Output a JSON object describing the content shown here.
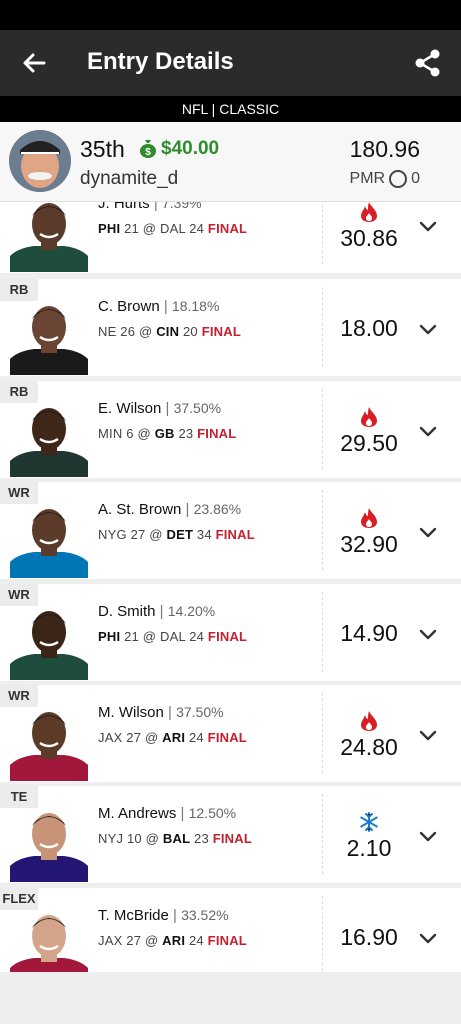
{
  "header": {
    "title": "Entry Details",
    "subtitle": "NFL | CLASSIC"
  },
  "entry": {
    "rank": "35th",
    "winnings": "$40.00",
    "username": "dynamite_d",
    "score": "180.96",
    "pmr_label": "PMR",
    "pmr_value": "0"
  },
  "colors": {
    "accent_green": "#2e8b2e",
    "final_red": "#c4212f",
    "hot": "#d91f26",
    "cold": "#1b7fcc"
  },
  "players": [
    {
      "pos": "",
      "name": "J. Hurts",
      "own": "7.39%",
      "t1": "PHI",
      "s1": "21",
      "at": "@",
      "t2": "DAL",
      "s2": "24",
      "status": "FINAL",
      "bold_team": "t1",
      "points": "30.86",
      "trend": "hot-icon",
      "skin": "#5a3a2a",
      "jersey": "#1f4d3d"
    },
    {
      "pos": "RB",
      "name": "C. Brown",
      "own": "18.18%",
      "t1": "NE",
      "s1": "26",
      "at": "@",
      "t2": "CIN",
      "s2": "20",
      "status": "FINAL",
      "bold_team": "t2",
      "points": "18.00",
      "trend": "",
      "skin": "#6b4533",
      "jersey": "#1a1a1a"
    },
    {
      "pos": "RB",
      "name": "E. Wilson",
      "own": "37.50%",
      "t1": "MIN",
      "s1": "6",
      "at": "@",
      "t2": "GB",
      "s2": "23",
      "status": "FINAL",
      "bold_team": "t2",
      "points": "29.50",
      "trend": "hot-icon",
      "skin": "#3e2619",
      "jersey": "#203731"
    },
    {
      "pos": "WR",
      "name": "A. St. Brown",
      "own": "23.86%",
      "t1": "NYG",
      "s1": "27",
      "at": "@",
      "t2": "DET",
      "s2": "34",
      "status": "FINAL",
      "bold_team": "t2",
      "points": "32.90",
      "trend": "hot-icon",
      "skin": "#5d3b2a",
      "jersey": "#0076b6"
    },
    {
      "pos": "WR",
      "name": "D. Smith",
      "own": "14.20%",
      "t1": "PHI",
      "s1": "21",
      "at": "@",
      "t2": "DAL",
      "s2": "24",
      "status": "FINAL",
      "bold_team": "t1",
      "points": "14.90",
      "trend": "",
      "skin": "#3b2418",
      "jersey": "#1f4d3d"
    },
    {
      "pos": "WR",
      "name": "M. Wilson",
      "own": "37.50%",
      "t1": "JAX",
      "s1": "27",
      "at": "@",
      "t2": "ARI",
      "s2": "24",
      "status": "FINAL",
      "bold_team": "t2",
      "points": "24.80",
      "trend": "hot-icon",
      "skin": "#5b3a28",
      "jersey": "#a3173a"
    },
    {
      "pos": "TE",
      "name": "M. Andrews",
      "own": "12.50%",
      "t1": "NYJ",
      "s1": "10",
      "at": "@",
      "t2": "BAL",
      "s2": "23",
      "status": "FINAL",
      "bold_team": "t2",
      "points": "2.10",
      "trend": "cold-icon",
      "skin": "#c89477",
      "jersey": "#241773"
    },
    {
      "pos": "FLEX",
      "name": "T. McBride",
      "own": "33.52%",
      "t1": "JAX",
      "s1": "27",
      "at": "@",
      "t2": "ARI",
      "s2": "24",
      "status": "FINAL",
      "bold_team": "t2",
      "points": "16.90",
      "trend": "",
      "skin": "#d4a48a",
      "jersey": "#a3173a"
    }
  ]
}
